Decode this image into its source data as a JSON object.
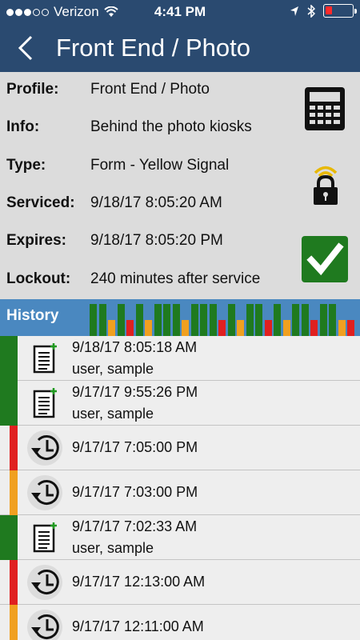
{
  "status_bar": {
    "carrier": "Verizon",
    "time": "4:41 PM",
    "signal_bars_filled": 3,
    "signal_bars_total": 5,
    "battery_level": 0.2,
    "icons": [
      "wifi-icon",
      "location-icon",
      "bluetooth-icon",
      "battery-icon"
    ]
  },
  "nav": {
    "back_icon": "chevron-left-icon",
    "title": "Front End / Photo"
  },
  "details": {
    "profile": {
      "label": "Profile:",
      "value": "Front End / Photo"
    },
    "info": {
      "label": "Info:",
      "value": "Behind the photo kiosks"
    },
    "type": {
      "label": "Type:",
      "value": "Form - Yellow Signal"
    },
    "serviced": {
      "label": "Serviced:",
      "value": "9/18/17  8:05:20 AM"
    },
    "expires": {
      "label": "Expires:",
      "value": "9/18/17  8:05:20 PM"
    },
    "lockout": {
      "label": "Lockout:",
      "value": "240 minutes after service"
    }
  },
  "action_icons": [
    "calculator-icon",
    "lock-signal-icon",
    "checkmark-icon"
  ],
  "colors": {
    "header": "#2a4a70",
    "history_bar": "#4a88c0",
    "green": "#1f7a1f",
    "red": "#e02020",
    "orange": "#f0a020"
  },
  "history": {
    "label": "History",
    "timeline": [
      "green",
      "green",
      "orange",
      "green",
      "red",
      "green",
      "orange",
      "green",
      "green",
      "green",
      "orange",
      "green",
      "green",
      "green",
      "red",
      "green",
      "orange",
      "green",
      "green",
      "red",
      "green",
      "orange",
      "green",
      "green",
      "red",
      "green",
      "green",
      "orange",
      "red"
    ]
  },
  "history_items": [
    {
      "status": "green",
      "icon": "form-document-icon",
      "datetime": "9/18/17  8:05:18 AM",
      "user": "user, sample"
    },
    {
      "status": "green",
      "icon": "form-document-icon",
      "datetime": "9/17/17  9:55:26 PM",
      "user": "user, sample"
    },
    {
      "status": "red",
      "icon": "history-clock-icon",
      "datetime": "9/17/17  7:05:00 PM",
      "user": ""
    },
    {
      "status": "orange",
      "icon": "history-clock-icon",
      "datetime": "9/17/17  7:03:00 PM",
      "user": ""
    },
    {
      "status": "green",
      "icon": "form-document-icon",
      "datetime": "9/17/17  7:02:33 AM",
      "user": "user, sample"
    },
    {
      "status": "red",
      "icon": "history-clock-icon",
      "datetime": "9/17/17  12:13:00 AM",
      "user": ""
    },
    {
      "status": "orange",
      "icon": "history-clock-icon",
      "datetime": "9/17/17  12:11:00 AM",
      "user": ""
    }
  ]
}
